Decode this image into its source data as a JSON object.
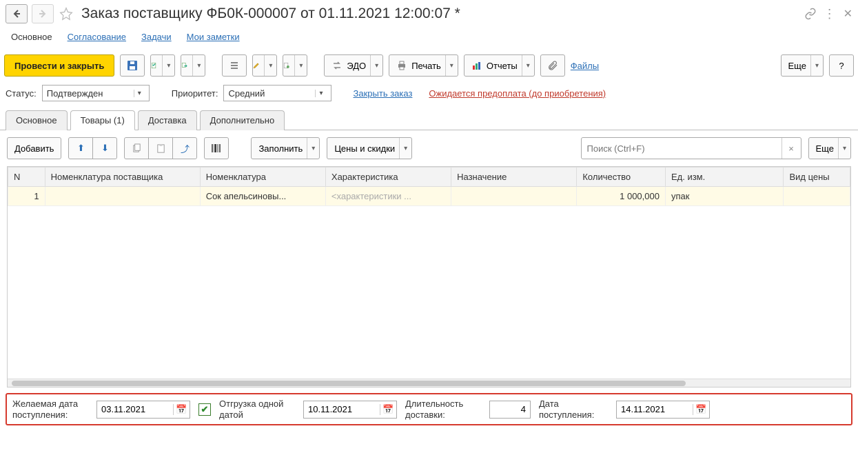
{
  "header": {
    "title": "Заказ поставщику ФБ0К-000007 от 01.11.2021 12:00:07 *"
  },
  "nav": {
    "main": "Основное",
    "approval": "Согласование",
    "tasks": "Задачи",
    "notes": "Мои заметки"
  },
  "toolbar": {
    "post_close": "Провести и закрыть",
    "edo": "ЭДО",
    "print": "Печать",
    "reports": "Отчеты",
    "files": "Файлы",
    "more": "Еще",
    "help": "?"
  },
  "status": {
    "status_label": "Статус:",
    "status_value": "Подтвержден",
    "priority_label": "Приоритет:",
    "priority_value": "Средний",
    "close_order": "Закрыть заказ",
    "prepay_expected": "Ожидается предоплата (до приобретения)"
  },
  "tabs": {
    "main": "Основное",
    "goods": "Товары (1)",
    "delivery": "Доставка",
    "extra": "Дополнительно"
  },
  "subtoolbar": {
    "add": "Добавить",
    "fill": "Заполнить",
    "prices": "Цены и скидки",
    "search_placeholder": "Поиск (Ctrl+F)",
    "more": "Еще"
  },
  "table": {
    "cols": {
      "n": "N",
      "supplier_nomen": "Номенклатура поставщика",
      "nomen": "Номенклатура",
      "char": "Характеристика",
      "dest": "Назначение",
      "qty": "Количество",
      "unit": "Ед. изм.",
      "price_type": "Вид цены"
    },
    "rows": [
      {
        "n": "1",
        "supplier_nomen": "",
        "nomen": "Сок апельсиновы...",
        "char": "<характеристики ...",
        "dest": "",
        "qty": "1 000,000",
        "unit": "упак",
        "price_type": ""
      }
    ]
  },
  "footer": {
    "desired_date_label": "Желаемая дата поступления:",
    "desired_date": "03.11.2021",
    "single_shipment_label": "Отгрузка одной датой",
    "ship_date": "10.11.2021",
    "duration_label": "Длительность доставки:",
    "duration": "4",
    "receipt_label": "Дата поступления:",
    "receipt_date": "14.11.2021"
  }
}
